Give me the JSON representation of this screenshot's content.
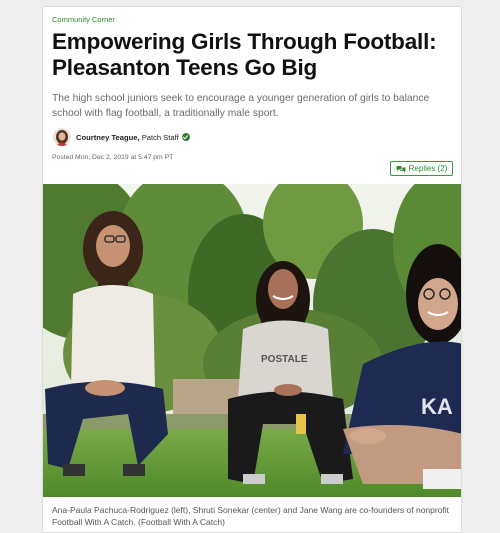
{
  "article": {
    "category": "Community Corner",
    "title": "Empowering Girls Through Football: Pleasanton Teens Go Big",
    "subtitle": "The high school juniors seek to encourage a younger generation of girls to balance school with flag football, a traditionally male sport.",
    "author_name": "Courtney Teague,",
    "author_role": "Patch Staff",
    "posted": "Posted Mon, Dec 2, 2019 at 5:47 pm PT",
    "replies_label": "Replies (2)",
    "photo_caption": "Ana-Paula Pachuca-Rodriguez (left), Shruti Sonekar (center) and Jane Wang are co-founders of nonprofit Football With A Catch. (Football With A Catch)"
  },
  "colors": {
    "accent": "#2e8b2e",
    "verified_badge": "#2e7d32"
  },
  "icons": {
    "verified": "verified-check-icon",
    "replies": "chat-bubbles-icon"
  }
}
